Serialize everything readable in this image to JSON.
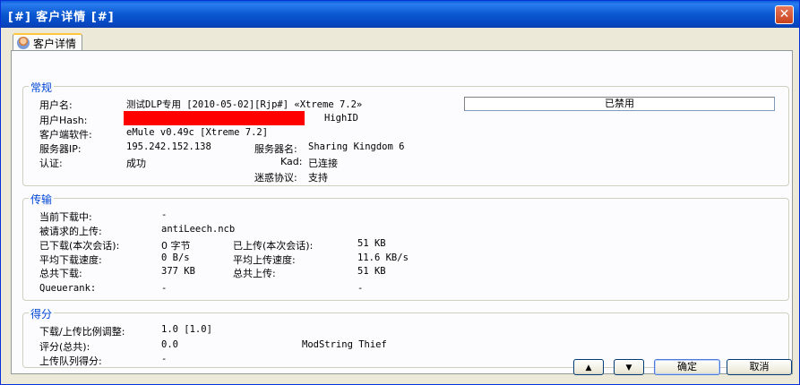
{
  "window": {
    "title": "[#] 客户详情 [#]",
    "close_glyph": "✕"
  },
  "tab": {
    "label": "客户详情",
    "icon": "user-icon"
  },
  "general": {
    "title": "常规",
    "username_label": "用户名:",
    "username_value": "测试DLP专用 [2010-05-02][Rjp#] «Xtreme 7.2»",
    "status_value": "已禁用",
    "hash_label": "用户Hash:",
    "id_type": "HighID",
    "client_software_label": "客户端软件:",
    "client_software_value": "eMule v0.49c [Xtreme 7.2]",
    "server_ip_label": "服务器IP:",
    "server_ip_value": "195.242.152.138",
    "server_name_label": "服务器名:",
    "server_name_value": "Sharing Kingdom 6",
    "auth_label": "认证:",
    "auth_value": "成功",
    "kad_label": "Kad:",
    "kad_value": "已连接",
    "obfuscation_label": "迷惑协议:",
    "obfuscation_value": "支持"
  },
  "transfer": {
    "title": "传输",
    "current_download_label": "当前下载中:",
    "current_download_value": "-",
    "requested_upload_label": "被请求的上传:",
    "requested_upload_value": "antiLeech.ncb",
    "downloaded_session_label": "已下载(本次会话):",
    "downloaded_session_value": "0 字节",
    "uploaded_session_label": "已上传(本次会话):",
    "uploaded_session_value": "51 KB",
    "avg_download_label": "平均下载速度:",
    "avg_download_value": "0 B/s",
    "avg_upload_label": "平均上传速度:",
    "avg_upload_value": "11.6 KB/s",
    "total_download_label": "总共下载:",
    "total_download_value": "377 KB",
    "total_upload_label": "总共上传:",
    "total_upload_value": "51 KB",
    "queuerank_label": "Queuerank:",
    "queuerank_value": "-",
    "queuerank_value2": "-"
  },
  "score": {
    "title": "得分",
    "ratio_label": "下载/上传比例调整:",
    "ratio_value": "1.0 [1.0]",
    "rating_label": "评分(总共):",
    "rating_value": "0.0",
    "mod_string": "ModString Thief",
    "queue_score_label": "上传队列得分:",
    "queue_score_value": "-"
  },
  "buttons": {
    "up_glyph": "▲",
    "down_glyph": "▼",
    "ok_label": "确定",
    "cancel_label": "取消"
  },
  "colors": {
    "redaction": "#ff0000",
    "group_title": "#0046d5",
    "titlebar": "#0a58d0"
  }
}
